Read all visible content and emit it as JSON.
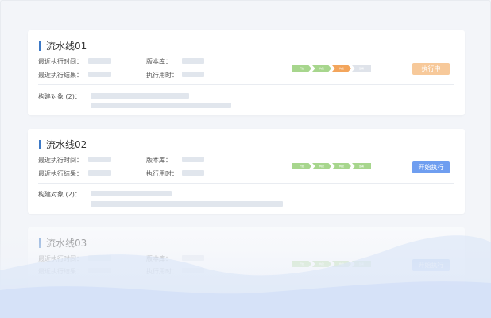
{
  "colors": {
    "accent": "#3d79c6",
    "success": "#a7d68d",
    "running": "#f3a55c",
    "pending": "#dfe3ea",
    "btn_running": "#f7c99a",
    "btn_start": "#6f9ef0"
  },
  "labels": {
    "last_time": "最近执行时间：",
    "last_result": "最近执行结果：",
    "repo": "版本库：",
    "duration": "执行用时："
  },
  "cards": [
    {
      "title": "流水线01",
      "build_label": "构建对象 (2)：",
      "button_label": "执行中",
      "stages": [
        {
          "label": "开始",
          "status": "success"
        },
        {
          "label": "构建",
          "status": "success"
        },
        {
          "label": "构建",
          "status": "running"
        },
        {
          "label": "部署",
          "status": "pending"
        }
      ]
    },
    {
      "title": "流水线02",
      "build_label": "构建对象 (2)：",
      "button_label": "开始执行",
      "stages": [
        {
          "label": "开始",
          "status": "success"
        },
        {
          "label": "构建",
          "status": "success"
        },
        {
          "label": "构建",
          "status": "success"
        },
        {
          "label": "部署",
          "status": "success"
        }
      ]
    },
    {
      "title": "流水线03",
      "button_label": "开始执行",
      "stages": [
        {
          "label": "开始",
          "status": "success"
        },
        {
          "label": "构建",
          "status": "success"
        },
        {
          "label": "构建",
          "status": "success"
        },
        {
          "label": "部署",
          "status": "success"
        }
      ]
    }
  ]
}
